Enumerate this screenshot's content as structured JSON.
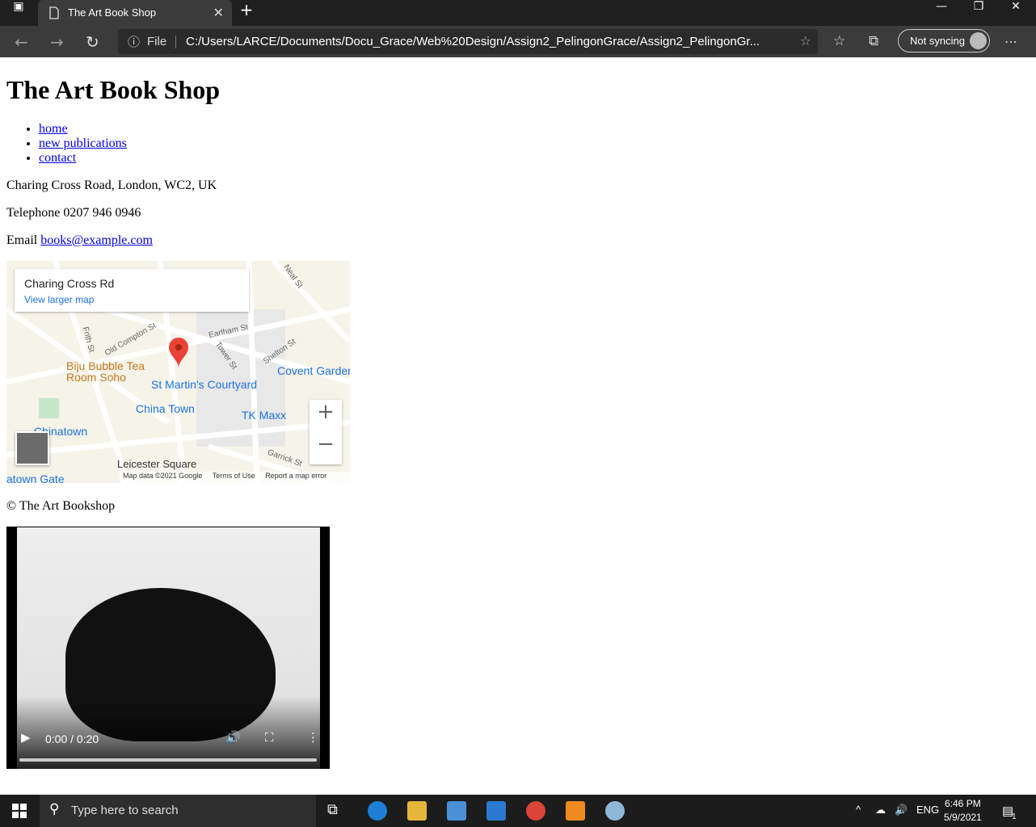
{
  "browser": {
    "tab_title": "The Art Book Shop",
    "addr_scheme": "File",
    "url": "C:/Users/LARCE/Documents/Docu_Grace/Web%20Design/Assign2_PelingonGrace/Assign2_PelingonGr...",
    "sync_label": "Not syncing"
  },
  "page": {
    "title": "The Art Book Shop",
    "nav": [
      "home",
      "new publications",
      "contact"
    ],
    "address": "Charing Cross Road, London, WC2, UK",
    "telephone": "Telephone 0207 946 0946",
    "email_label": "Email ",
    "email": "books@example.com",
    "copyright": "© The Art Bookshop"
  },
  "map": {
    "place": "Charing Cross Rd",
    "link": "View larger map",
    "labels": [
      "Biju Bubble Tea",
      "Room Soho",
      "St Martin's Courtyard",
      "Covent Garden",
      "China Town",
      "TK Maxx",
      "Chinatown",
      "Leicester Square",
      "atown Gate",
      "Earlham St",
      "Old Compton St",
      "Shelton St",
      "Garrick St",
      "Neal St",
      "Frith St",
      "Tower St"
    ],
    "footer": [
      "Map data ©2021 Google",
      "Terms of Use",
      "Report a map error"
    ],
    "zoom_in": "+",
    "zoom_out": "−"
  },
  "video": {
    "time": "0:00 / 0:20"
  },
  "taskbar": {
    "search_placeholder": "Type here to search",
    "lang": "ENG",
    "time": "6:46 PM",
    "date": "5/9/2021",
    "notifications": "1"
  }
}
